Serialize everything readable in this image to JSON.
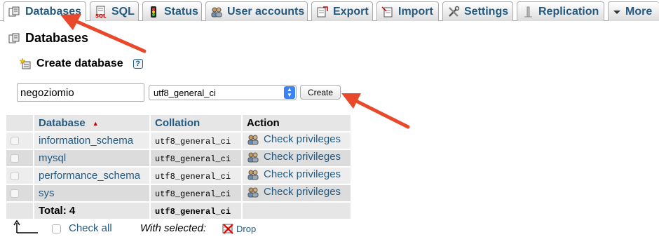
{
  "tabs": [
    {
      "label": "Databases",
      "icon": "database-icon",
      "active": true
    },
    {
      "label": "SQL",
      "icon": "sql-icon"
    },
    {
      "label": "Status",
      "icon": "status-icon"
    },
    {
      "label": "User accounts",
      "icon": "user-accounts-icon"
    },
    {
      "label": "Export",
      "icon": "export-icon"
    },
    {
      "label": "Import",
      "icon": "import-icon"
    },
    {
      "label": "Settings",
      "icon": "settings-icon"
    },
    {
      "label": "Replication",
      "icon": "replication-icon"
    },
    {
      "label": "More",
      "icon": "chevron-down-icon"
    }
  ],
  "page_title": "Databases",
  "create": {
    "title": "Create database",
    "db_name_value": "negoziomio",
    "collation_value": "utf8_general_ci",
    "button_label": "Create"
  },
  "table": {
    "headers": {
      "database": "Database",
      "collation": "Collation",
      "action": "Action"
    },
    "rows": [
      {
        "name": "information_schema",
        "collation": "utf8_general_ci",
        "action": "Check privileges"
      },
      {
        "name": "mysql",
        "collation": "utf8_general_ci",
        "action": "Check privileges"
      },
      {
        "name": "performance_schema",
        "collation": "utf8_general_ci",
        "action": "Check privileges"
      },
      {
        "name": "sys",
        "collation": "utf8_general_ci",
        "action": "Check privileges"
      }
    ],
    "total_label": "Total: 4",
    "total_collation": "utf8_general_ci"
  },
  "footer": {
    "check_all": "Check all",
    "with_selected": "With selected:",
    "drop": "Drop"
  },
  "colors": {
    "link": "#235a81",
    "annotation_arrow": "#e8492a"
  }
}
